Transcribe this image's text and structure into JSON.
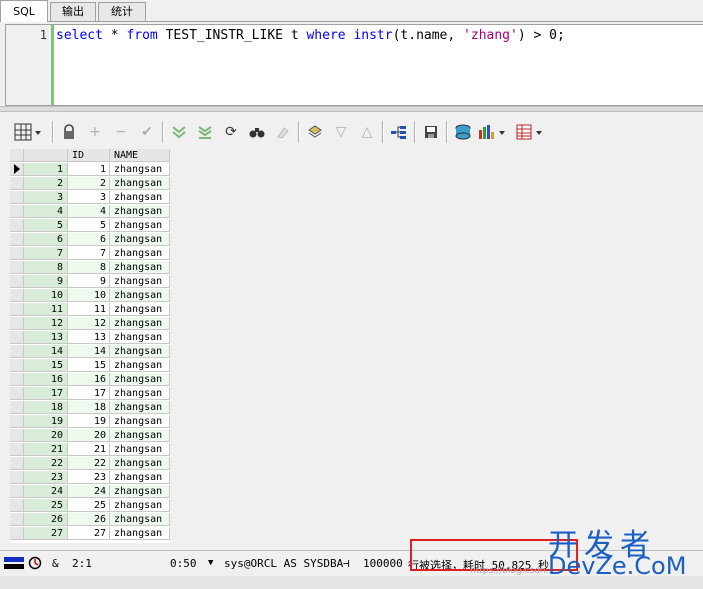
{
  "tabs": [
    "SQL",
    "输出",
    "统计"
  ],
  "editor": {
    "line_number": "1",
    "code": {
      "t1": "select",
      "t2": " * ",
      "t3": "from",
      "t4": " TEST_INSTR_LIKE t ",
      "t5": "where",
      "t6": " ",
      "t7": "instr",
      "t8": "(t.name, ",
      "t9": "'zhang'",
      "t10": ") > 0;"
    }
  },
  "toolbar": {
    "icons": [
      "grid-view-icon",
      "lock-icon",
      "plus-icon",
      "minus-icon",
      "check-icon",
      "fetch-next-icon",
      "fetch-all-icon",
      "refresh-icon",
      "find-icon",
      "clear-icon",
      "query-by-example-icon",
      "sort-desc-icon",
      "sort-asc-icon",
      "explain-plan-icon",
      "save-icon",
      "export-icon",
      "chart-icon",
      "table-icon"
    ]
  },
  "grid": {
    "columns": [
      "ID",
      "NAME"
    ],
    "rows": [
      [
        "1",
        "1",
        "zhangsan"
      ],
      [
        "2",
        "2",
        "zhangsan"
      ],
      [
        "3",
        "3",
        "zhangsan"
      ],
      [
        "4",
        "4",
        "zhangsan"
      ],
      [
        "5",
        "5",
        "zhangsan"
      ],
      [
        "6",
        "6",
        "zhangsan"
      ],
      [
        "7",
        "7",
        "zhangsan"
      ],
      [
        "8",
        "8",
        "zhangsan"
      ],
      [
        "9",
        "9",
        "zhangsan"
      ],
      [
        "10",
        "10",
        "zhangsan"
      ],
      [
        "11",
        "11",
        "zhangsan"
      ],
      [
        "12",
        "12",
        "zhangsan"
      ],
      [
        "13",
        "13",
        "zhangsan"
      ],
      [
        "14",
        "14",
        "zhangsan"
      ],
      [
        "15",
        "15",
        "zhangsan"
      ],
      [
        "16",
        "16",
        "zhangsan"
      ],
      [
        "17",
        "17",
        "zhangsan"
      ],
      [
        "18",
        "18",
        "zhangsan"
      ],
      [
        "19",
        "19",
        "zhangsan"
      ],
      [
        "20",
        "20",
        "zhangsan"
      ],
      [
        "21",
        "21",
        "zhangsan"
      ],
      [
        "22",
        "22",
        "zhangsan"
      ],
      [
        "23",
        "23",
        "zhangsan"
      ],
      [
        "24",
        "24",
        "zhangsan"
      ],
      [
        "25",
        "25",
        "zhangsan"
      ],
      [
        "26",
        "26",
        "zhangsan"
      ],
      [
        "27",
        "27",
        "zhangsan"
      ]
    ]
  },
  "status": {
    "ampersand": "&",
    "position": "2:1",
    "time": "0:50",
    "connection": "sys@ORCL AS SYSDBA",
    "row_limit": "100000",
    "message": "行被选择，耗时 50.825 秒"
  },
  "watermark": {
    "line1": "开发者",
    "line2": "DevZe.CoM",
    "url": "https://blog.csdn..."
  },
  "colors": {
    "keyword": "#0000ff",
    "string": "#a00080",
    "rownum_bg": "#d8ecd8",
    "highlight_box": "#e02020",
    "watermark": "#1a5fc4"
  }
}
